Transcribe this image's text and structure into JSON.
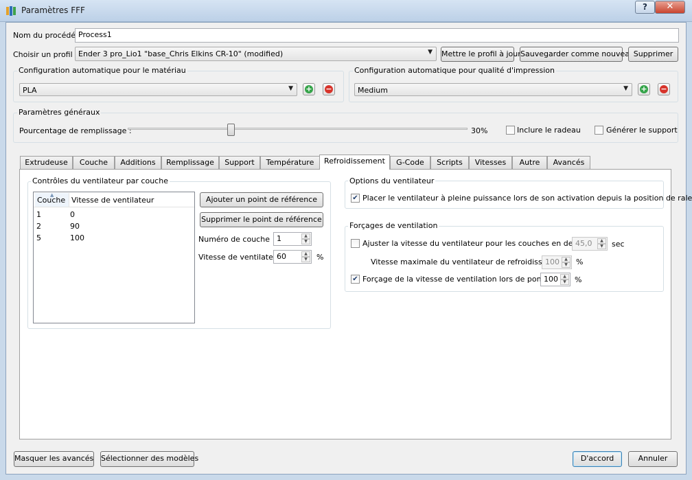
{
  "window": {
    "title": "Paramètres FFF",
    "help": "?",
    "close": "✕"
  },
  "process": {
    "label": "Nom du procédé :",
    "value": "Process1"
  },
  "profile": {
    "label": "Choisir un profil :",
    "value": "Ender 3 pro_Lio1 \"base_Chris Elkins CR-10\" (modified)",
    "update_btn": "Mettre le profil à jour",
    "save_new_btn": "Sauvegarder comme nouveau",
    "delete_btn": "Supprimer"
  },
  "material": {
    "title": "Configuration automatique pour le matériau",
    "value": "PLA"
  },
  "quality": {
    "title": "Configuration automatique pour qualité d'impression",
    "value": "Medium"
  },
  "general": {
    "title": "Paramètres généraux",
    "infill_label": "Pourcentage de remplissage :",
    "infill_value": "30%",
    "infill_fraction": 0.3,
    "raft_label": "Inclure le radeau",
    "raft_checked": false,
    "support_label": "Générer le support",
    "support_checked": false
  },
  "tabs": [
    {
      "label": "Extrudeuse",
      "active": false
    },
    {
      "label": "Couche",
      "active": false
    },
    {
      "label": "Additions",
      "active": false
    },
    {
      "label": "Remplissage",
      "active": false
    },
    {
      "label": "Support",
      "active": false
    },
    {
      "label": "Température",
      "active": false
    },
    {
      "label": "Refroidissement",
      "active": true
    },
    {
      "label": "G-Code",
      "active": false
    },
    {
      "label": "Scripts",
      "active": false
    },
    {
      "label": "Vitesses",
      "active": false
    },
    {
      "label": "Autre",
      "active": false
    },
    {
      "label": "Avancés",
      "active": false
    }
  ],
  "fan_controls": {
    "title": "Contrôles du ventilateur par couche",
    "headers": [
      "Couche",
      "Vitesse de ventilateur"
    ],
    "rows": [
      [
        "1",
        "0"
      ],
      [
        "2",
        "90"
      ],
      [
        "5",
        "100"
      ]
    ],
    "add_btn": "Ajouter un point de référence",
    "remove_btn": "Supprimer le point de référence",
    "layer_label": "Numéro de couche",
    "layer_value": "1",
    "speed_label": "Vitesse de ventilateur",
    "speed_value": "60",
    "speed_unit": "%"
  },
  "fan_options": {
    "title": "Options du ventilateur",
    "full_power_label": "Placer le ventilateur à pleine puissance lors de son activation depuis la position de ralenti",
    "full_power_checked": true
  },
  "overrides": {
    "title": "Forçages de ventilation",
    "adjust_label": "Ajuster la vitesse du ventilateur pour les couches en dessous",
    "adjust_checked": false,
    "adjust_value": "45,0",
    "adjust_unit": "sec",
    "max_label": "Vitesse maximale du ventilateur de refroidissement",
    "max_value": "100",
    "max_unit": "%",
    "bridge_label": "Forçage de la vitesse de ventilation lors de pontage",
    "bridge_checked": true,
    "bridge_value": "100",
    "bridge_unit": "%"
  },
  "footer": {
    "hide_advanced": "Masquer les avancés",
    "select_models": "Sélectionner des modèles",
    "ok": "D'accord",
    "cancel": "Annuler"
  }
}
